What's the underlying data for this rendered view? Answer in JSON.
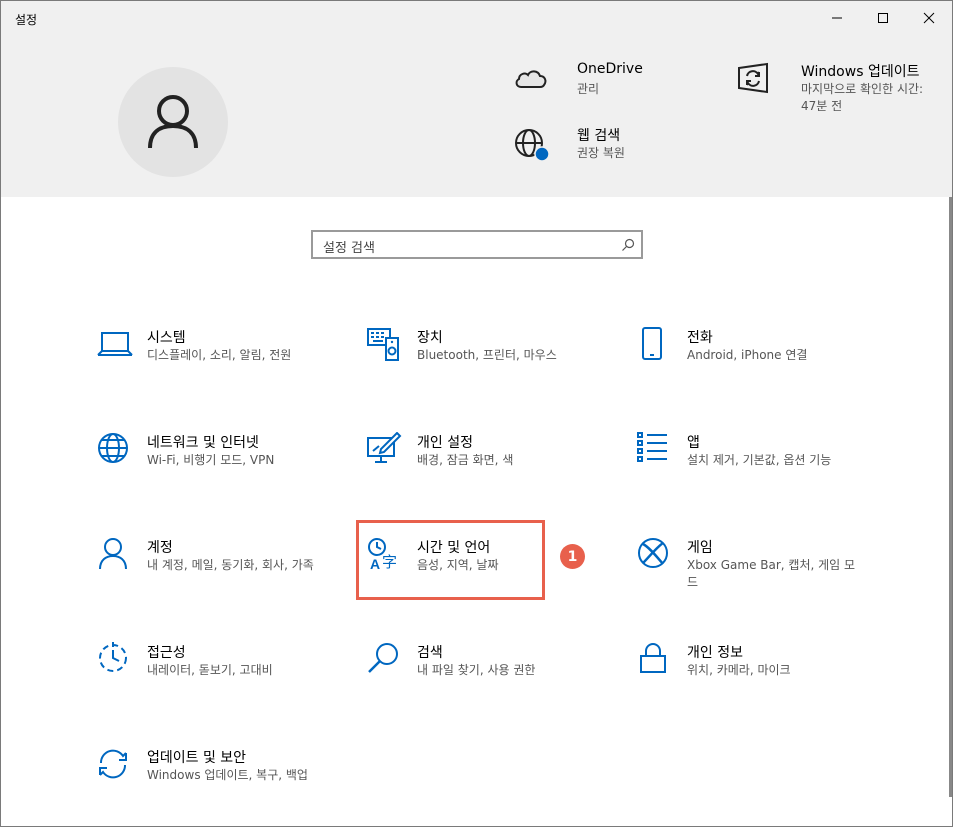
{
  "window": {
    "title": "설정",
    "controls": {
      "minimize_icon": "minimize-icon",
      "maximize_icon": "maximize-icon",
      "close_icon": "close-icon"
    }
  },
  "hero": {
    "onedrive": {
      "title": "OneDrive",
      "sub": "관리"
    },
    "websearch": {
      "title": "웹 검색",
      "sub": "권장 복원"
    },
    "update": {
      "title": "Windows 업데이트",
      "sub": "마지막으로 확인한 시간: 47분 전"
    }
  },
  "search": {
    "placeholder": "설정 검색"
  },
  "tiles": {
    "system": {
      "title": "시스템",
      "sub": "디스플레이, 소리, 알림, 전원"
    },
    "devices": {
      "title": "장치",
      "sub": "Bluetooth, 프린터, 마우스"
    },
    "phone": {
      "title": "전화",
      "sub": "Android, iPhone 연결"
    },
    "network": {
      "title": "네트워크 및 인터넷",
      "sub": "Wi-Fi, 비행기 모드, VPN"
    },
    "personalization": {
      "title": "개인 설정",
      "sub": "배경, 잠금 화면, 색"
    },
    "apps": {
      "title": "앱",
      "sub": "설치 제거, 기본값, 옵션 기능"
    },
    "accounts": {
      "title": "계정",
      "sub": "내 계정, 메일, 동기화, 회사, 가족"
    },
    "time_language": {
      "title": "시간 및 언어",
      "sub": "음성, 지역, 날짜"
    },
    "gaming": {
      "title": "게임",
      "sub": "Xbox Game Bar, 캡처, 게임 모드"
    },
    "ease": {
      "title": "접근성",
      "sub": "내레이터, 돋보기, 고대비"
    },
    "search_tile": {
      "title": "검색",
      "sub": "내 파일 찾기, 사용 권한"
    },
    "privacy": {
      "title": "개인 정보",
      "sub": "위치, 카메라, 마이크"
    },
    "update_security": {
      "title": "업데이트 및 보안",
      "sub": "Windows 업데이트, 복구, 백업"
    }
  },
  "annotation": {
    "badge": "1"
  },
  "colors": {
    "accent": "#0067c0",
    "highlight": "#e8604c"
  }
}
